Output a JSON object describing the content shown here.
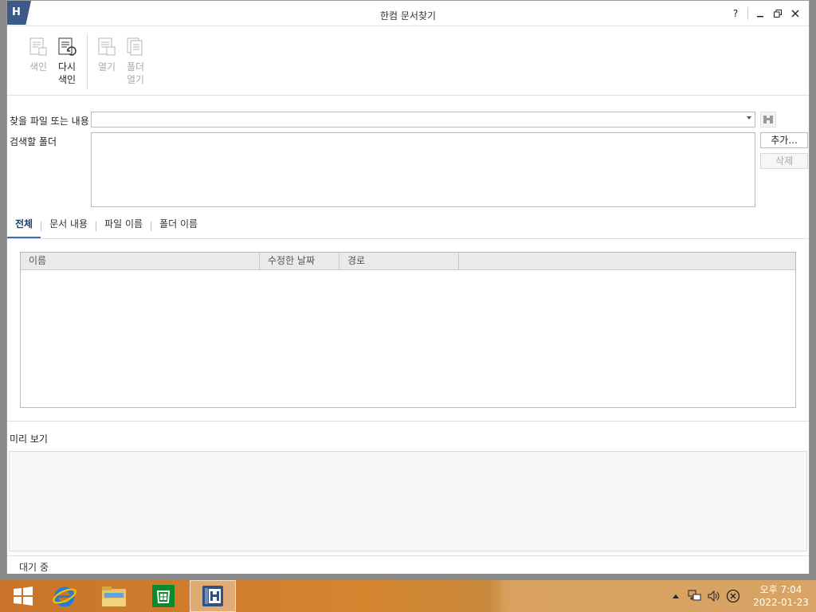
{
  "window": {
    "title": "한컴 문서찾기",
    "controls": {
      "help": "?",
      "minimize": "–",
      "restore": "🗗",
      "close": "✕"
    }
  },
  "ribbon": {
    "index_label": "색인",
    "reindex_label_1": "다시",
    "reindex_label_2": "색인",
    "open_label": "열기",
    "open_folder_label_1": "폴더",
    "open_folder_label_2": "열기"
  },
  "search": {
    "query_label": "찾을 파일 또는 내용",
    "query_value": "",
    "folder_label": "검색할 폴더",
    "add_button": "추가...",
    "delete_button": "삭제"
  },
  "tabs": [
    {
      "label": "전체",
      "active": true
    },
    {
      "label": "문서 내용",
      "active": false
    },
    {
      "label": "파일 이름",
      "active": false
    },
    {
      "label": "폴더 이름",
      "active": false
    }
  ],
  "results": {
    "columns": [
      "이름",
      "수정한 날짜",
      "경로",
      ""
    ],
    "rows": []
  },
  "preview": {
    "label": "미리 보기"
  },
  "status": {
    "text": "대기 중"
  },
  "taskbar": {
    "clock_time": "오후 7:04",
    "clock_date": "2022-01-23"
  },
  "colors": {
    "accent": "#3e6cb5",
    "logo": "#3c5a88",
    "taskbar": "#c9742a"
  }
}
